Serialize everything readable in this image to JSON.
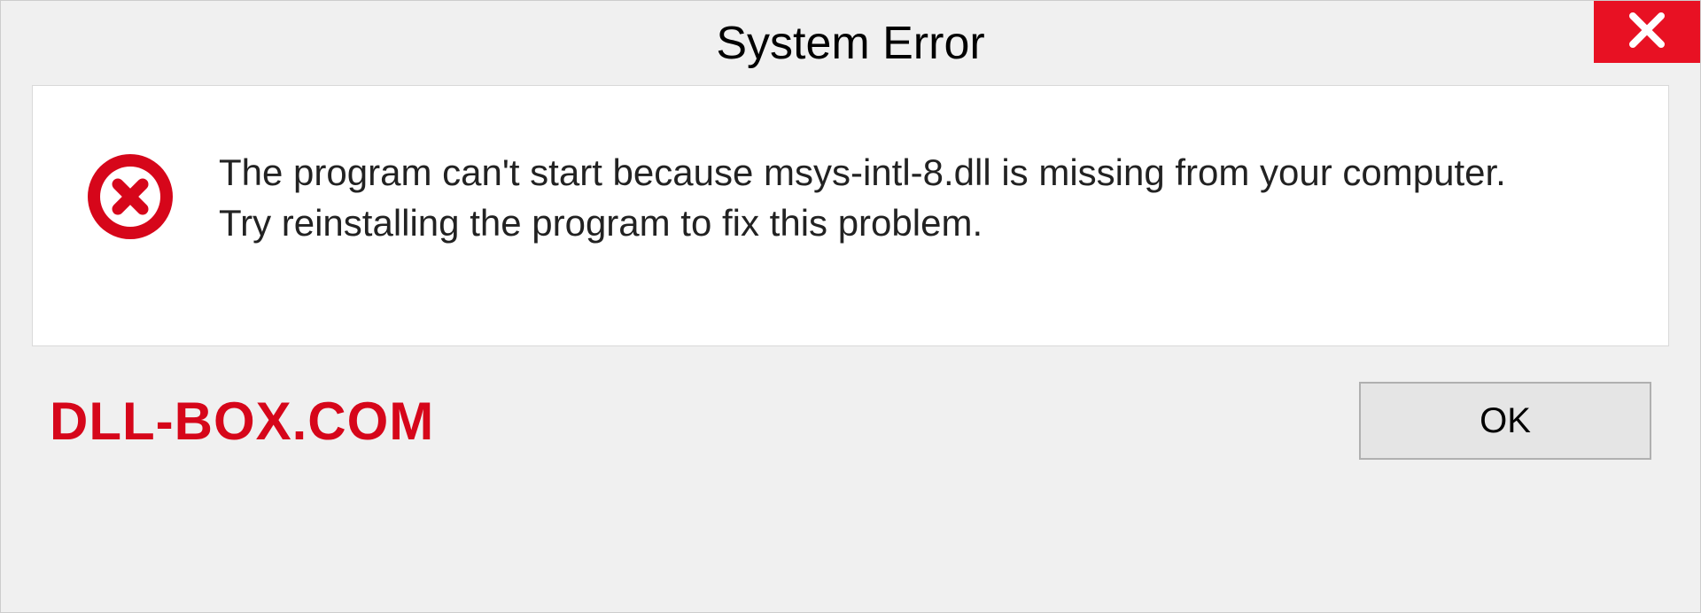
{
  "titlebar": {
    "title": "System Error"
  },
  "content": {
    "message": "The program can't start because msys-intl-8.dll is missing from your computer. Try reinstalling the program to fix this problem."
  },
  "footer": {
    "watermark": "DLL-BOX.COM",
    "ok_label": "OK"
  },
  "colors": {
    "close_bg": "#e81123",
    "error_icon": "#d6061a",
    "watermark": "#d6061a"
  }
}
